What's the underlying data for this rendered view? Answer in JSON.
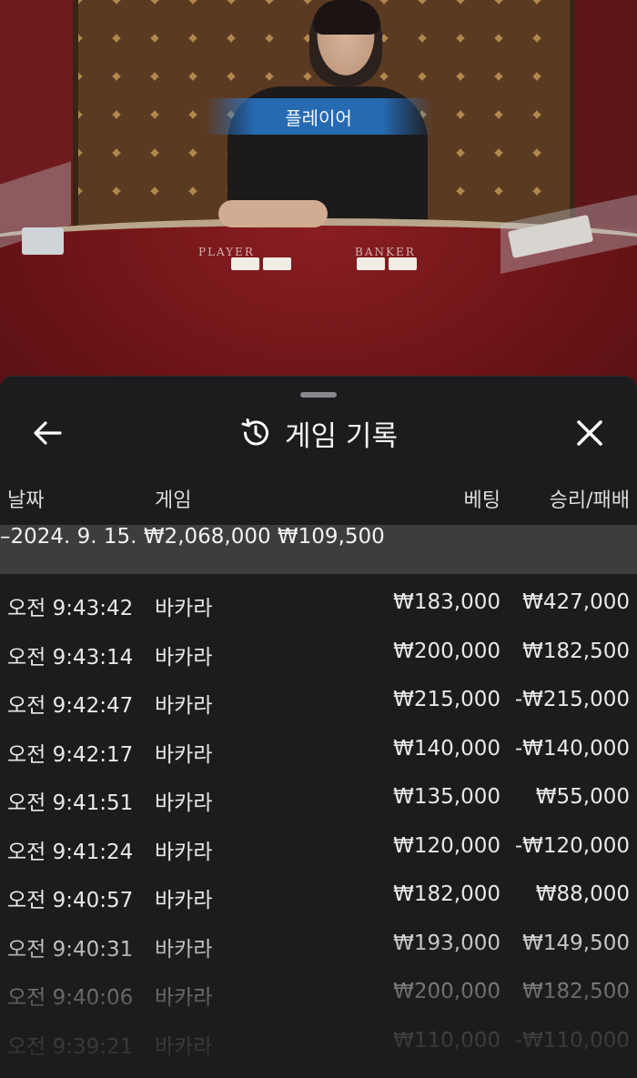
{
  "video": {
    "banner_label": "플레이어",
    "table_player_label": "PLAYER",
    "table_banker_label": "BANKER"
  },
  "header": {
    "title": "게임 기록",
    "back_icon": "arrow-left-icon",
    "history_icon": "history-icon",
    "close_icon": "close-icon"
  },
  "columns": {
    "date": "날짜",
    "game": "게임",
    "bet": "베팅",
    "win_loss": "승리/패배"
  },
  "day_summary": {
    "date": "–2024. 9. 15.",
    "bet": "₩2,068,000",
    "win_loss": "₩109,500"
  },
  "rows": [
    {
      "time": "오전 9:43:42",
      "game": "바카라",
      "bet": "₩183,000",
      "win_loss": "₩427,000"
    },
    {
      "time": "오전 9:43:14",
      "game": "바카라",
      "bet": "₩200,000",
      "win_loss": "₩182,500"
    },
    {
      "time": "오전 9:42:47",
      "game": "바카라",
      "bet": "₩215,000",
      "win_loss": "-₩215,000"
    },
    {
      "time": "오전 9:42:17",
      "game": "바카라",
      "bet": "₩140,000",
      "win_loss": "-₩140,000"
    },
    {
      "time": "오전 9:41:51",
      "game": "바카라",
      "bet": "₩135,000",
      "win_loss": "₩55,000"
    },
    {
      "time": "오전 9:41:24",
      "game": "바카라",
      "bet": "₩120,000",
      "win_loss": "-₩120,000"
    },
    {
      "time": "오전 9:40:57",
      "game": "바카라",
      "bet": "₩182,000",
      "win_loss": "₩88,000"
    },
    {
      "time": "오전 9:40:31",
      "game": "바카라",
      "bet": "₩193,000",
      "win_loss": "₩149,500"
    },
    {
      "time": "오전 9:40:06",
      "game": "바카라",
      "bet": "₩200,000",
      "win_loss": "₩182,500"
    },
    {
      "time": "오전 9:39:21",
      "game": "바카라",
      "bet": "₩110,000",
      "win_loss": "-₩110,000"
    }
  ]
}
